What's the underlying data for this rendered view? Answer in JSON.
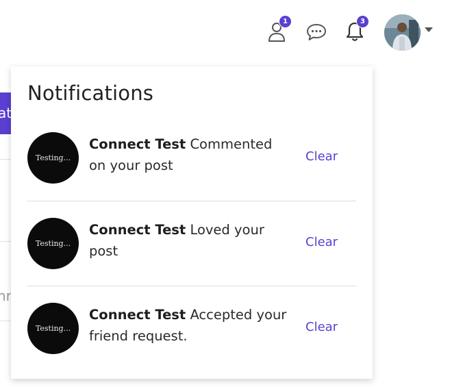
{
  "header": {
    "friend_requests_badge": "1",
    "notifications_badge": "3"
  },
  "background": {
    "button_fragment": "at",
    "text_fragment": "nr"
  },
  "panel": {
    "title": "Notifications",
    "clear_label": "Clear",
    "items": [
      {
        "avatar_text": "Testing...",
        "user": "Connect Test",
        "message": "Commented on your post"
      },
      {
        "avatar_text": "Testing...",
        "user": "Connect Test",
        "message": "Loved your post"
      },
      {
        "avatar_text": "Testing...",
        "user": "Connect Test",
        "message": "Accepted your friend request."
      }
    ]
  },
  "colors": {
    "accent": "#5b3fd1",
    "avatar_bg": "#0b0b0b"
  },
  "icons": [
    "user-icon",
    "chat-icon",
    "bell-icon",
    "avatar",
    "caret-down-icon"
  ]
}
